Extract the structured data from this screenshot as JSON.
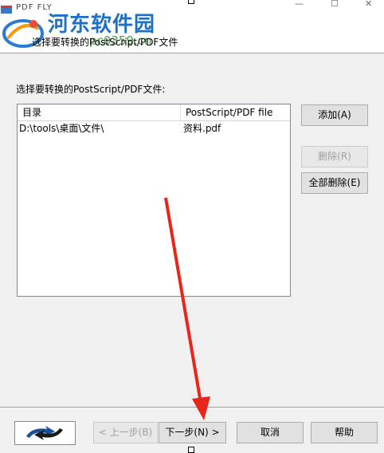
{
  "window": {
    "app_title": "PDF FLY",
    "minimize_glyph": "—",
    "maximize_glyph": "☐",
    "close_glyph": "✕"
  },
  "watermark": {
    "site_name": "河东软件园",
    "url": "pc0359.cn"
  },
  "header": {
    "title": "选择要转换的PostScript/PDF文件"
  },
  "main": {
    "section_label": "选择要转换的PostScript/PDF文件:",
    "list": {
      "columns": [
        "目录",
        "PostScript/PDF file"
      ],
      "rows": [
        {
          "dir": "D:\\tools\\桌面\\文件\\",
          "file": "资料.pdf"
        }
      ]
    },
    "buttons": {
      "add": "添加(A)",
      "delete": "删除(R)",
      "delete_all": "全部删除(E)"
    }
  },
  "footer": {
    "back": "< 上一步(B)",
    "next": "下一步(N) >",
    "cancel": "取消",
    "help": "帮助"
  },
  "colors": {
    "annotation_arrow": "#e8261c",
    "watermark_blue": "#1f6fc2",
    "watermark_green": "#4aa04a"
  }
}
